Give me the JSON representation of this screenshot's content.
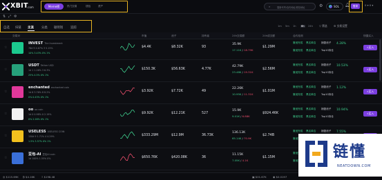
{
  "brand": {
    "logo_text": "XBIT",
    "logo_suffix": ".com"
  },
  "nav": {
    "active": "Meme榜",
    "items": [
      "热门交易",
      "钱包",
      "资产"
    ]
  },
  "search": {
    "placeholder": "搜索代币/合约地址/钱包地址"
  },
  "chain": {
    "label": "SOL"
  },
  "login": {
    "label": "登录"
  },
  "wallet": {
    "text": "0 ▾ 0 ▾"
  },
  "tabs": [
    "自选",
    "扫链",
    "主流",
    "分类",
    "聪明钱",
    "追踪"
  ],
  "tabs_active_index": 2,
  "periods": [
    "1m",
    "5m",
    "1h",
    "6h",
    "24h"
  ],
  "periods_active_index": 3,
  "filters": {
    "filter": "筛选",
    "settings": "交易设置"
  },
  "columns": [
    "交易对",
    "市值",
    "池子",
    "持有者",
    "24h交易额",
    "24h成交额",
    "合约检测",
    "",
    "快捷买入"
  ],
  "rows": [
    {
      "name": "INVEST",
      "full": "The Investment",
      "meta": "76d  9  4.67%  3  5.15%",
      "stats": "10%  3.43%  0%  1%",
      "mcap": "$4.4K",
      "pool": "$8.32K",
      "holders": "93",
      "vol": "35.9K",
      "vol_buy": "17.11K",
      "vol_sell": "18.79K",
      "turnover": "$1.29M",
      "audit": [
        "撤池完成",
        "黑名单否",
        "销毁池子"
      ],
      "top": "Top10持仓",
      "pct": "4.28%",
      "color": "#1bc98e"
    },
    {
      "name": "USDT",
      "full": "Tether USD",
      "meta": "1d  1  1.26%  3  6.3%",
      "stats": "25%  4.5%  0%  1%",
      "mcap": "$150.3K",
      "pool": "$56.63K",
      "holders": "4.77K",
      "vol": "42.79K",
      "vol_buy": "23.48K",
      "vol_sell": "19.31K",
      "turnover": "$2.56M",
      "audit": [
        "撤池完成",
        "黑名单否",
        "销毁池子"
      ],
      "top": "Top10持仓",
      "pct": "10.53%",
      "color": "#26a17b"
    },
    {
      "name": "enchanted",
      "full": "enchanted coin",
      "meta": "1d  6  3.76%  8  8.2%",
      "stats": "0%  0.43%  0%  1%",
      "mcap": "$3.92K",
      "pool": "$7.72K",
      "holders": "49",
      "vol": "22.26K",
      "vol_buy": "10.95K",
      "vol_sell": "11.31K",
      "turnover": "$1.01M",
      "audit": [
        "撤池完成",
        "黑名单否",
        "销毁池子"
      ],
      "top": "Top10持仓",
      "pct": "1.12%",
      "color": "#e0389a"
    },
    {
      "name": "oo",
      "full": "oo coin",
      "meta": "1d  0  0.98%  0  2.19%",
      "stats": "0%  2.26%  0%  1%",
      "mcap": "$9.92K",
      "pool": "$12.21K",
      "holders": "527",
      "vol": "15.9K",
      "vol_buy": "9.01K",
      "vol_sell": "6.88K",
      "turnover": "$924.46K",
      "audit": [
        "撤池完成",
        "黑名单否",
        "销毁池子"
      ],
      "top": "Top10持仓",
      "pct": "10.94%",
      "color": "#f2f2f2"
    },
    {
      "name": "USELESS",
      "full": "USELESS COIN",
      "meta": "150d  9  1.71%  4  4.29%",
      "stats": "1.5%  3.57%  0%  1%",
      "mcap": "$333.29M",
      "pool": "$12.9M",
      "holders": "36.73K",
      "vol": "136.13K",
      "vol_buy": "65.14K",
      "vol_sell": "70.9K",
      "turnover": "$2.74B",
      "audit": [
        "撤池完成",
        "黑名单否",
        "销毁池子"
      ],
      "top": "Top10持仓",
      "pct": "7.55%",
      "color": "#f2c01e"
    },
    {
      "name": "豆包-AI",
      "full": "豆包AI coin",
      "meta": "1d  100%  1.55%  0%",
      "stats": "",
      "mcap": "$650.76K",
      "pool": "$420.08K",
      "holders": "36",
      "vol": "11.15K",
      "vol_buy": "7.05K",
      "vol_sell": "4.1K",
      "turnover": "$1.15M",
      "audit": [
        "撤池完成",
        "黑名单否",
        "销毁池子"
      ],
      "top": "Top10持仓",
      "pct": "",
      "color": "#3a6fd8"
    }
  ],
  "buy_label": "⚡买入",
  "footer": {
    "sol": "$115.69K",
    "btc": "$4.16K",
    "eth": "$198.48",
    "right1": "$01.67K",
    "right2": "$0.0197"
  },
  "watermark": {
    "text": "链懂",
    "sub": "NEATDOWN.COM"
  }
}
